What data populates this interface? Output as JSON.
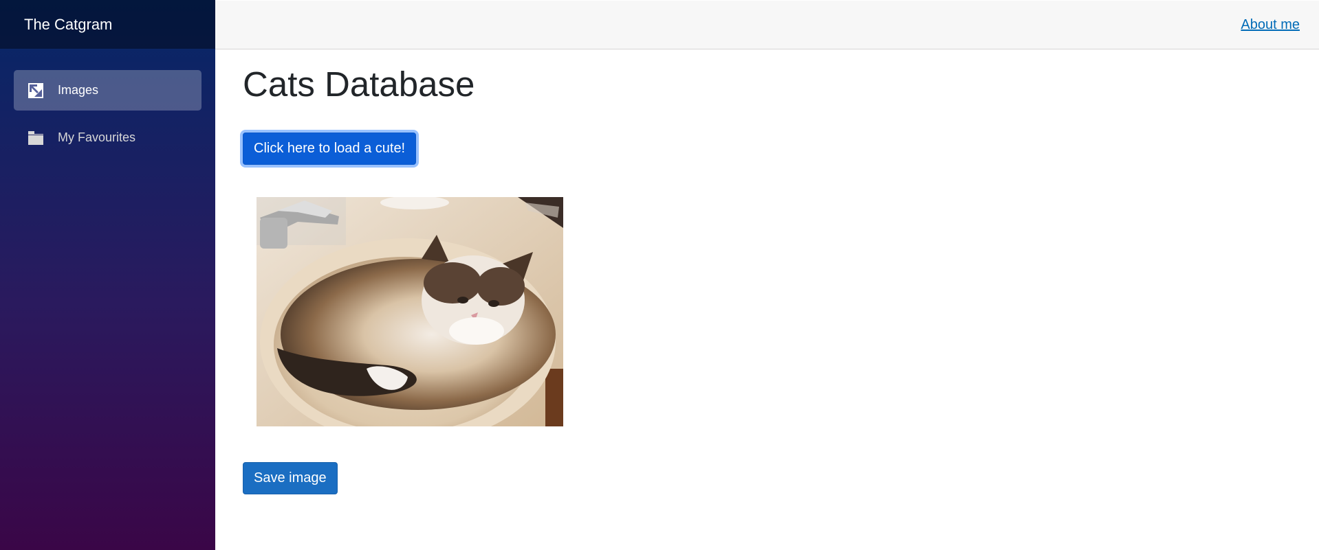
{
  "sidebar": {
    "brand": "The Catgram",
    "items": [
      {
        "label": "Images",
        "icon": "image-icon",
        "active": true
      },
      {
        "label": "My Favourites",
        "icon": "folder-icon",
        "active": false
      }
    ]
  },
  "top_row": {
    "about_label": "About me"
  },
  "main": {
    "title": "Cats Database",
    "load_button": "Click here to load a cute!",
    "save_button": "Save image"
  },
  "colors": {
    "accent": "#1b6ec2",
    "link": "#006bb7",
    "sidebar_top": "#052767",
    "sidebar_bottom": "#3a0647"
  }
}
